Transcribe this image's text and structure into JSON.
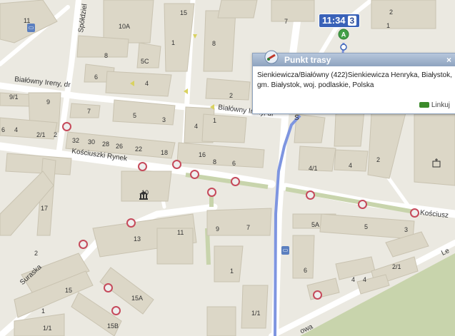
{
  "streets": {
    "bialowny_left": "Białówny Ireny, dr",
    "bialowny_right": "Białówny Ireny, dr",
    "kosciuszki_rynek": "Kościuszki Rynek",
    "kosciuszki_right": "Kościusz",
    "spoldzielcza": "Spółdziel",
    "suraska": "Suraska",
    "ledzka": "Le",
    "lipowa": "owa",
    "s_partial": "S"
  },
  "building_numbers": [
    "11",
    "15",
    "10A",
    "8",
    "5C",
    "1",
    "8",
    "6",
    "4",
    "7",
    "9/1",
    "9",
    "7",
    "5",
    "3",
    "4",
    "1",
    "2",
    "6",
    "4",
    "2/1",
    "2",
    "32",
    "30",
    "28",
    "26",
    "22",
    "18",
    "10",
    "16",
    "8",
    "6",
    "4/1",
    "4",
    "2",
    "17",
    "13",
    "11",
    "9",
    "7",
    "5A",
    "5",
    "3",
    "2",
    "1",
    "4",
    "6",
    "2/1",
    "15A",
    "15",
    "1",
    "1/1",
    "15B",
    "1/1",
    "2",
    "4",
    "1"
  ],
  "popup": {
    "title": "Punkt trasy",
    "close": "×",
    "address": "Sienkiewicza/Białówny (422)Sienkiewicza Henryka, Białystok, gm. Białystok, woj. podlaskie, Polska",
    "link": "Linkuj"
  },
  "clock": {
    "time": "11:34",
    "line": "3"
  },
  "marker": "A",
  "colors": {
    "route": "#7e95e0",
    "stop_ring": "#c64a5b",
    "popup_header": "#8ea3bf",
    "park": "#c8d4ac"
  }
}
